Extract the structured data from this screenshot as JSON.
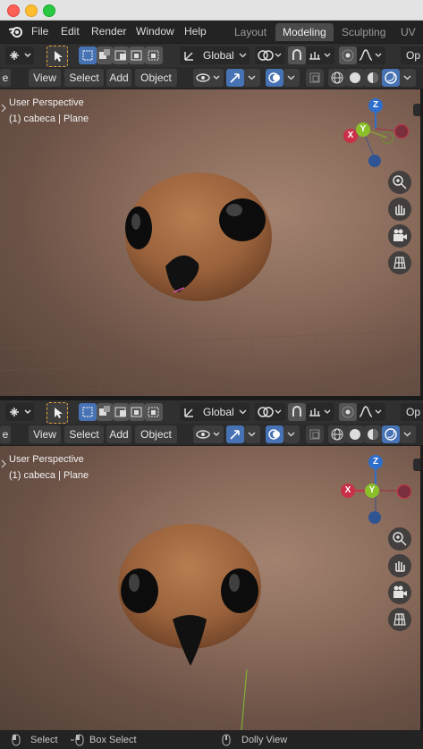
{
  "menu": {
    "file": "File",
    "edit": "Edit",
    "render": "Render",
    "window": "Window",
    "help": "Help"
  },
  "workspaces": [
    "Layout",
    "Modeling",
    "Sculpting",
    "UV E"
  ],
  "toolbar": {
    "orientation": "Global",
    "options_partial": "Op"
  },
  "view_header": {
    "view": "View",
    "select": "Select",
    "add": "Add",
    "object": "Object",
    "edge_partial": "e"
  },
  "viewport_top": {
    "perspective": "User Perspective",
    "object_info": "(1) cabeca | Plane"
  },
  "viewport_bottom": {
    "perspective": "User Perspective",
    "object_info": "(1) cabeca | Plane"
  },
  "gizmo": {
    "x": "X",
    "y": "Y",
    "z": "Z"
  },
  "status": {
    "select": "Select",
    "box_select": "Box Select",
    "dolly": "Dolly View"
  },
  "colors": {
    "x_axis": "#c93048",
    "y_axis": "#8bbf2a",
    "z_axis": "#2f6fcb",
    "accent": "#4772b3"
  }
}
